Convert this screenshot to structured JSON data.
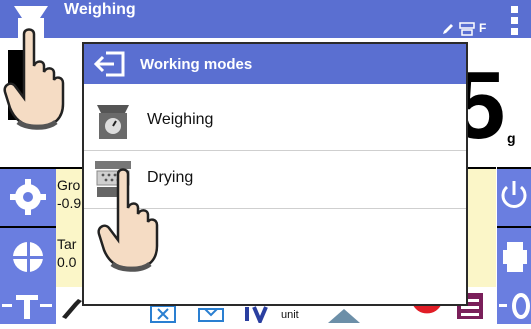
{
  "topbar": {
    "mode_label": "Weighing",
    "indicators": [
      "pencil-icon",
      "balance-icon",
      "F"
    ],
    "menu_icon": "kebab-menu-icon"
  },
  "display": {
    "reading_partial": "5",
    "unit": "g"
  },
  "info_panel": {
    "gross_label": "Gro",
    "gross_value": "-0.9",
    "tare_label": "Tar",
    "tare_value": "0.0"
  },
  "dialog": {
    "title": "Working modes",
    "items": [
      {
        "label": "Weighing",
        "icon": "scale-icon"
      },
      {
        "label": "Drying",
        "icon": "drying-icon"
      }
    ]
  },
  "bottombar": {
    "unit_label": "unit"
  },
  "colors": {
    "accent": "#5a6fd1",
    "info_bg": "#fbf6c8",
    "record_red": "#e11d26",
    "purple": "#7a1f5a"
  }
}
